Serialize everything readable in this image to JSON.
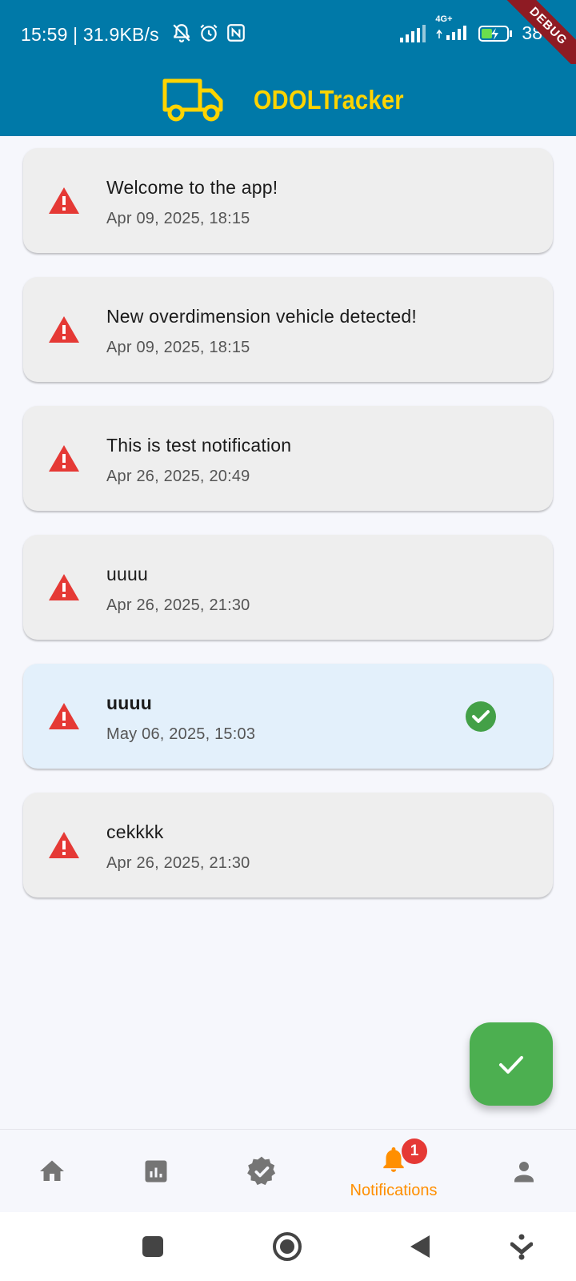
{
  "status_bar": {
    "time_speed": "15:59 | 31.9KB/s",
    "network_label": "4G+",
    "battery_percent": "38",
    "debug_banner": "DEBUG"
  },
  "app_bar": {
    "title": "ODOLTracker",
    "brand_color": "#ffd400",
    "background_color": "#0079a8"
  },
  "notifications": [
    {
      "title": "Welcome to the app!",
      "date": "Apr 09, 2025, 18:15",
      "unread": false
    },
    {
      "title": "New overdimension vehicle detected!",
      "date": "Apr 09, 2025, 18:15",
      "unread": false
    },
    {
      "title": "This is test notification",
      "date": "Apr 26, 2025, 20:49",
      "unread": false
    },
    {
      "title": "uuuu",
      "date": "Apr 26, 2025, 21:30",
      "unread": false
    },
    {
      "title": "uuuu",
      "date": "May 06, 2025, 15:03",
      "unread": true
    },
    {
      "title": "cekkkk",
      "date": "Apr 26, 2025, 21:30",
      "unread": false
    }
  ],
  "fab": {
    "icon": "check-icon",
    "color": "#4caf50"
  },
  "bottom_nav": {
    "items": [
      {
        "icon": "home-icon"
      },
      {
        "icon": "chart-icon"
      },
      {
        "icon": "verified-icon"
      },
      {
        "icon": "bell-icon",
        "label": "Notifications",
        "badge": "1",
        "active": true
      },
      {
        "icon": "person-icon"
      }
    ],
    "active_color": "#ff8f00",
    "inactive_color": "#757575"
  }
}
